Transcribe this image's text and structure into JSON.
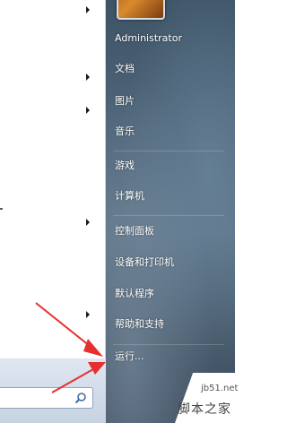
{
  "user": {
    "name": "Administrator"
  },
  "menu": {
    "items": [
      {
        "label": "文档"
      },
      {
        "label": "图片"
      },
      {
        "label": "音乐"
      },
      {
        "label": "游戏"
      },
      {
        "label": "计算机"
      },
      {
        "label": "控制面板"
      },
      {
        "label": "设备和打印机"
      },
      {
        "label": "默认程序"
      },
      {
        "label": "帮助和支持"
      },
      {
        "label": "运行..."
      }
    ]
  },
  "watermark": {
    "site": "jb51.net",
    "brand": "脚本之家"
  },
  "colors": {
    "annotation_arrow": "#e63030"
  }
}
